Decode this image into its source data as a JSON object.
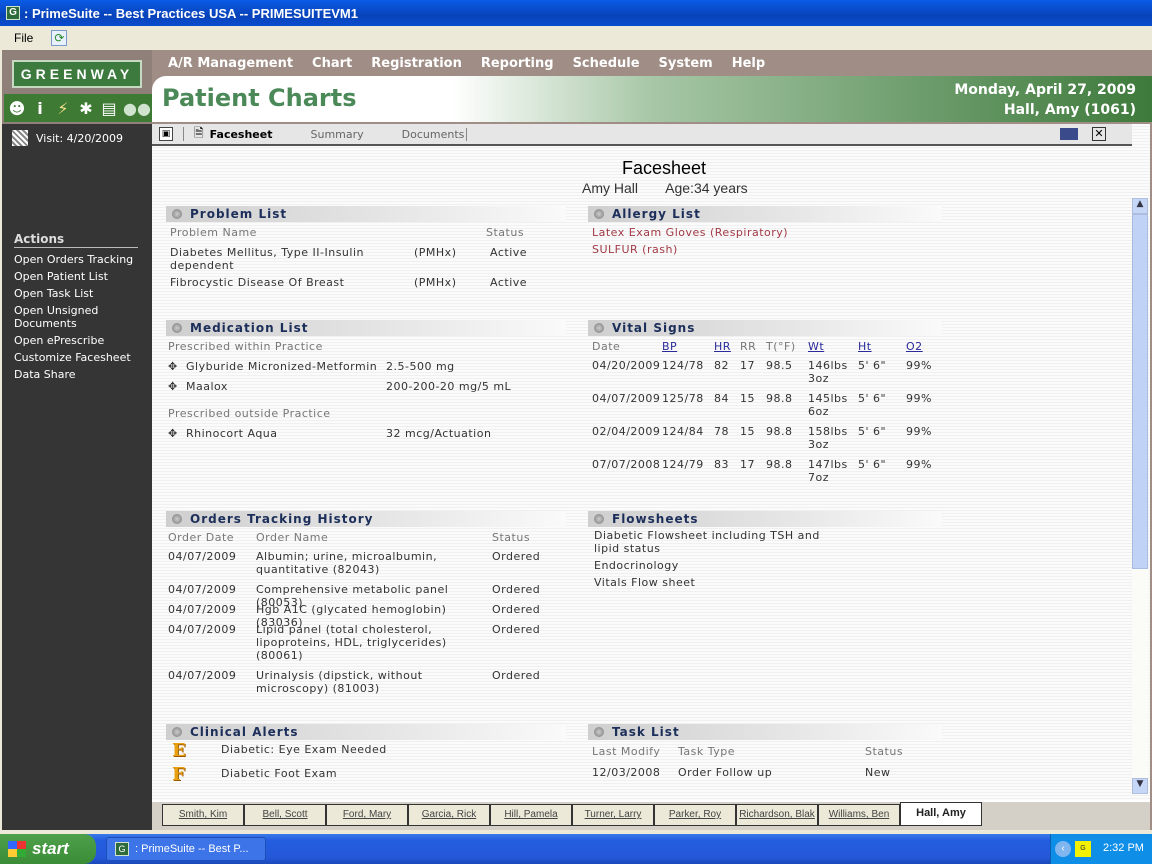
{
  "window": {
    "title": ": PrimeSuite -- Best Practices USA -- PRIMESUITEVM1",
    "app_icon": "G"
  },
  "menubar": {
    "file": "File",
    "refresh_icon": "refresh-icon"
  },
  "brand": {
    "logo": "GREENWAY",
    "accent": "#3e7a3b"
  },
  "topnav": [
    "A/R Management",
    "Chart",
    "Registration",
    "Reporting",
    "Schedule",
    "System",
    "Help"
  ],
  "banner": {
    "title": "Patient Charts",
    "date": "Monday, April 27, 2009",
    "patient": "Hall, Amy (1061)"
  },
  "iconbar": [
    "patient-search-icon",
    "info-icon",
    "note-icon",
    "stick-figure-icon",
    "document-icon",
    "group-icon"
  ],
  "leftpanel": {
    "visit": "Visit: 4/20/2009",
    "actions_header": "Actions",
    "actions": [
      "Open Orders Tracking",
      "Open Patient List",
      "Open Task List",
      "Open Unsigned Documents",
      "Open ePrescribe",
      "Customize Facesheet",
      "Data Share"
    ]
  },
  "tabs": {
    "active": "Facesheet",
    "summary": "Summary",
    "documents": "Documents"
  },
  "facesheet": {
    "title": "Facesheet",
    "patient_name": "Amy Hall",
    "age": "Age:34 years"
  },
  "problem_list": {
    "title": "Problem List",
    "headers": {
      "name": "Problem Name",
      "status": "Status"
    },
    "rows": [
      {
        "name": "Diabetes Mellitus, Type II-Insulin dependent",
        "type": "(PMHx)",
        "status": "Active"
      },
      {
        "name": "Fibrocystic Disease Of Breast",
        "type": "(PMHx)",
        "status": "Active"
      }
    ]
  },
  "allergy_list": {
    "title": "Allergy List",
    "items": [
      "Latex Exam Gloves (Respiratory)",
      "SULFUR (rash)"
    ]
  },
  "medication_list": {
    "title": "Medication List",
    "within_label": "Prescribed within Practice",
    "within": [
      {
        "name": "Glyburide Micronized-Metformin",
        "dose": "2.5-500 mg"
      },
      {
        "name": "Maalox",
        "dose": "200-200-20 mg/5 mL"
      }
    ],
    "outside_label": "Prescribed outside Practice",
    "outside": [
      {
        "name": "Rhinocort Aqua",
        "dose": "32 mcg/Actuation"
      }
    ]
  },
  "vital_signs": {
    "title": "Vital Signs",
    "headers": [
      "Date",
      "BP",
      "HR",
      "RR",
      "T(°F)",
      "Wt",
      "Ht",
      "O2"
    ],
    "rows": [
      {
        "date": "04/20/2009",
        "bp": "124/78",
        "hr": "82",
        "rr": "17",
        "t": "98.5",
        "wt": "146lbs 3oz",
        "ht": "5' 6\"",
        "o2": "99%"
      },
      {
        "date": "04/07/2009",
        "bp": "125/78",
        "hr": "84",
        "rr": "15",
        "t": "98.8",
        "wt": "145lbs 6oz",
        "ht": "5' 6\"",
        "o2": "99%"
      },
      {
        "date": "02/04/2009",
        "bp": "124/84",
        "hr": "78",
        "rr": "15",
        "t": "98.8",
        "wt": "158lbs 3oz",
        "ht": "5' 6\"",
        "o2": "99%"
      },
      {
        "date": "07/07/2008",
        "bp": "124/79",
        "hr": "83",
        "rr": "17",
        "t": "98.8",
        "wt": "147lbs 7oz",
        "ht": "5' 6\"",
        "o2": "99%"
      }
    ]
  },
  "orders": {
    "title": "Orders Tracking History",
    "headers": {
      "date": "Order Date",
      "name": "Order Name",
      "status": "Status"
    },
    "rows": [
      {
        "date": "04/07/2009",
        "name": "Albumin; urine, microalbumin, quantitative (82043)",
        "status": "Ordered"
      },
      {
        "date": "04/07/2009",
        "name": "Comprehensive metabolic panel (80053)",
        "status": "Ordered"
      },
      {
        "date": "04/07/2009",
        "name": "Hgb A1C (glycated hemoglobin) (83036)",
        "status": "Ordered"
      },
      {
        "date": "04/07/2009",
        "name": "Lipid panel (total cholesterol, lipoproteins, HDL, triglycerides) (80061)",
        "status": "Ordered"
      },
      {
        "date": "04/07/2009",
        "name": "Urinalysis (dipstick, without microscopy) (81003)",
        "status": "Ordered"
      }
    ]
  },
  "flowsheets": {
    "title": "Flowsheets",
    "items": [
      "Diabetic Flowsheet including TSH and lipid status",
      "Endocrinology",
      "Vitals Flow sheet"
    ]
  },
  "clinical_alerts": {
    "title": "Clinical Alerts",
    "items": [
      {
        "icon": "E",
        "text": "Diabetic: Eye Exam Needed"
      },
      {
        "icon": "F",
        "text": "Diabetic Foot Exam"
      }
    ]
  },
  "task_list": {
    "title": "Task List",
    "headers": {
      "modified": "Last Modify",
      "type": "Task Type",
      "status": "Status"
    },
    "rows": [
      {
        "modified": "12/03/2008",
        "type": "Order Follow up",
        "status": "New"
      }
    ]
  },
  "patient_tabs": [
    "Smith, Kim",
    "Bell, Scott",
    "Ford, Mary",
    "Garcia, Rick",
    "Hill, Pamela",
    "Turner, Larry",
    "Parker, Roy",
    "Richardson, Blak",
    "Williams, Ben",
    "Hall, Amy"
  ],
  "active_patient_tab": "Hall, Amy",
  "taskbar": {
    "start": "start",
    "task": ": PrimeSuite -- Best P...",
    "clock": "2:32 PM"
  }
}
